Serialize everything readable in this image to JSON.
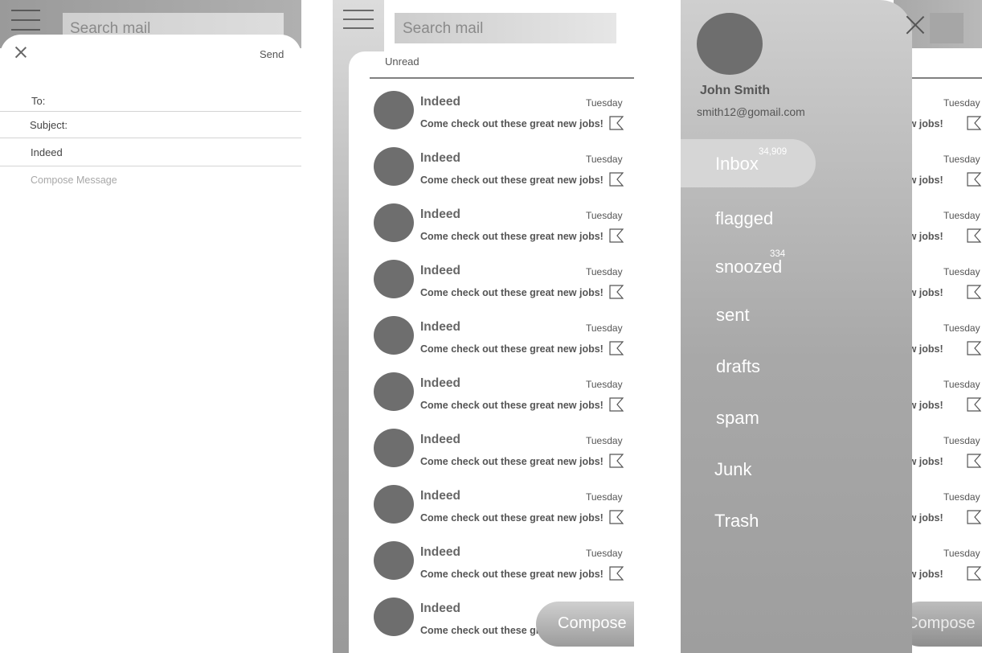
{
  "compose": {
    "search_placeholder": "Search mail",
    "send_label": "Send",
    "to_label": "To:",
    "subject_label": "Subject:",
    "from_value": "Indeed",
    "message_placeholder": "Compose Message"
  },
  "inbox": {
    "search_placeholder": "Search mail",
    "filter_tab": "Unread",
    "compose_label": "Compose",
    "emails": [
      {
        "sender": "Indeed",
        "date": "Tuesday",
        "subject": "Come check out these great new jobs!"
      },
      {
        "sender": "Indeed",
        "date": "Tuesday",
        "subject": "Come check out these great new jobs!"
      },
      {
        "sender": "Indeed",
        "date": "Tuesday",
        "subject": "Come check out these great new jobs!"
      },
      {
        "sender": "Indeed",
        "date": "Tuesday",
        "subject": "Come check out these great new jobs!"
      },
      {
        "sender": "Indeed",
        "date": "Tuesday",
        "subject": "Come check out these great new jobs!"
      },
      {
        "sender": "Indeed",
        "date": "Tuesday",
        "subject": "Come check out these great new jobs!"
      },
      {
        "sender": "Indeed",
        "date": "Tuesday",
        "subject": "Come check out these great new jobs!"
      },
      {
        "sender": "Indeed",
        "date": "Tuesday",
        "subject": "Come check out these great new jobs!"
      },
      {
        "sender": "Indeed",
        "date": "Tuesday",
        "subject": "Come check out these great new jobs!"
      },
      {
        "sender": "Indeed",
        "subject": "Come check out these gre"
      }
    ]
  },
  "drawer": {
    "user_name": "John Smith",
    "user_email": "smith12@gomail.com",
    "folders": [
      {
        "label": "Inbox",
        "count": "34,909"
      },
      {
        "label": "flagged"
      },
      {
        "label": "snoozed",
        "count": "334"
      },
      {
        "label": "sent"
      },
      {
        "label": "drafts"
      },
      {
        "label": "spam"
      },
      {
        "label": "Junk"
      },
      {
        "label": "Trash"
      }
    ],
    "background_rows": [
      {
        "date": "Tuesday",
        "subject": "new jobs!"
      },
      {
        "date": "Tuesday",
        "subject": "new jobs!"
      },
      {
        "date": "Tuesday",
        "subject": "new jobs!"
      },
      {
        "date": "Tuesday",
        "subject": "new jobs!"
      },
      {
        "date": "Tuesday",
        "subject": "new jobs!"
      },
      {
        "date": "Tuesday",
        "subject": "new jobs!"
      },
      {
        "date": "Tuesday",
        "subject": "new jobs!"
      },
      {
        "date": "Tuesday",
        "subject": "new jobs!"
      },
      {
        "date": "Tuesday",
        "subject": "new jobs!"
      }
    ],
    "background_compose_label": "Compose"
  },
  "icons": {
    "menu": "hamburger-menu-icon",
    "close": "close-icon",
    "flag": "flag-icon",
    "avatar": "avatar-circle"
  },
  "colors": {
    "avatar": "#6e6e6e",
    "drawer_gradient_top": "#cfcfcf",
    "drawer_gradient_bottom": "#9e9e9e",
    "active_pill": "#d6d6d6"
  }
}
